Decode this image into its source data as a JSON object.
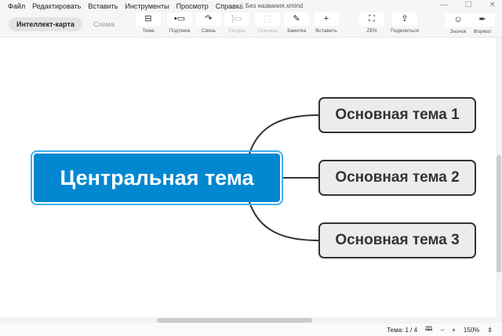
{
  "menu": [
    "Файл",
    "Редактировать",
    "Вставить",
    "Инструменты",
    "Просмотр",
    "Справка"
  ],
  "file_title": "Без названия.xmind",
  "window_controls": {
    "minimize": "—",
    "maximize": "☐",
    "close": "✕"
  },
  "view_tabs": [
    {
      "label": "Интеллект-карта",
      "active": true
    },
    {
      "label": "Схема",
      "active": false
    }
  ],
  "toolbar": [
    {
      "label": "Тема",
      "icon": "topic-icon",
      "glyph": "⊟",
      "disabled": false
    },
    {
      "label": "Подтема",
      "icon": "subtopic-icon",
      "glyph": "•▭",
      "disabled": false
    },
    {
      "label": "Связь",
      "icon": "relationship-icon",
      "glyph": "↷",
      "disabled": false
    },
    {
      "label": "Сводка",
      "icon": "summary-icon",
      "glyph": "}▭",
      "disabled": true
    },
    {
      "label": "Граница",
      "icon": "boundary-icon",
      "glyph": "⬚",
      "disabled": true
    },
    {
      "label": "Заметка",
      "icon": "note-icon",
      "glyph": "✎",
      "disabled": false
    },
    {
      "label": "Вставить",
      "icon": "plus-icon",
      "glyph": "+",
      "disabled": false
    },
    {
      "label": "ZEN",
      "icon": "zen-fullscreen-icon",
      "glyph": "⛶",
      "disabled": false
    },
    {
      "label": "Поделиться",
      "icon": "share-icon",
      "glyph": "⇪",
      "disabled": false
    },
    {
      "label": "Значок",
      "icon": "smiley-icon",
      "glyph": "☺",
      "disabled": false
    },
    {
      "label": "Формат",
      "icon": "format-brush-icon",
      "glyph": "✒",
      "disabled": false
    }
  ],
  "map": {
    "central": "Центральная тема",
    "topics": [
      "Основная тема 1",
      "Основная тема 2",
      "Основная тема 3"
    ]
  },
  "status": {
    "topic_count": "Тема: 1 / 4",
    "zoom_out": "−",
    "zoom_in": "+",
    "zoom": "150%",
    "zoom_toggle": "⇕",
    "map_icon": "🕮"
  },
  "colors": {
    "central": "#0288d1",
    "selection": "#3fb2ec",
    "topic_bg": "#ececec"
  }
}
